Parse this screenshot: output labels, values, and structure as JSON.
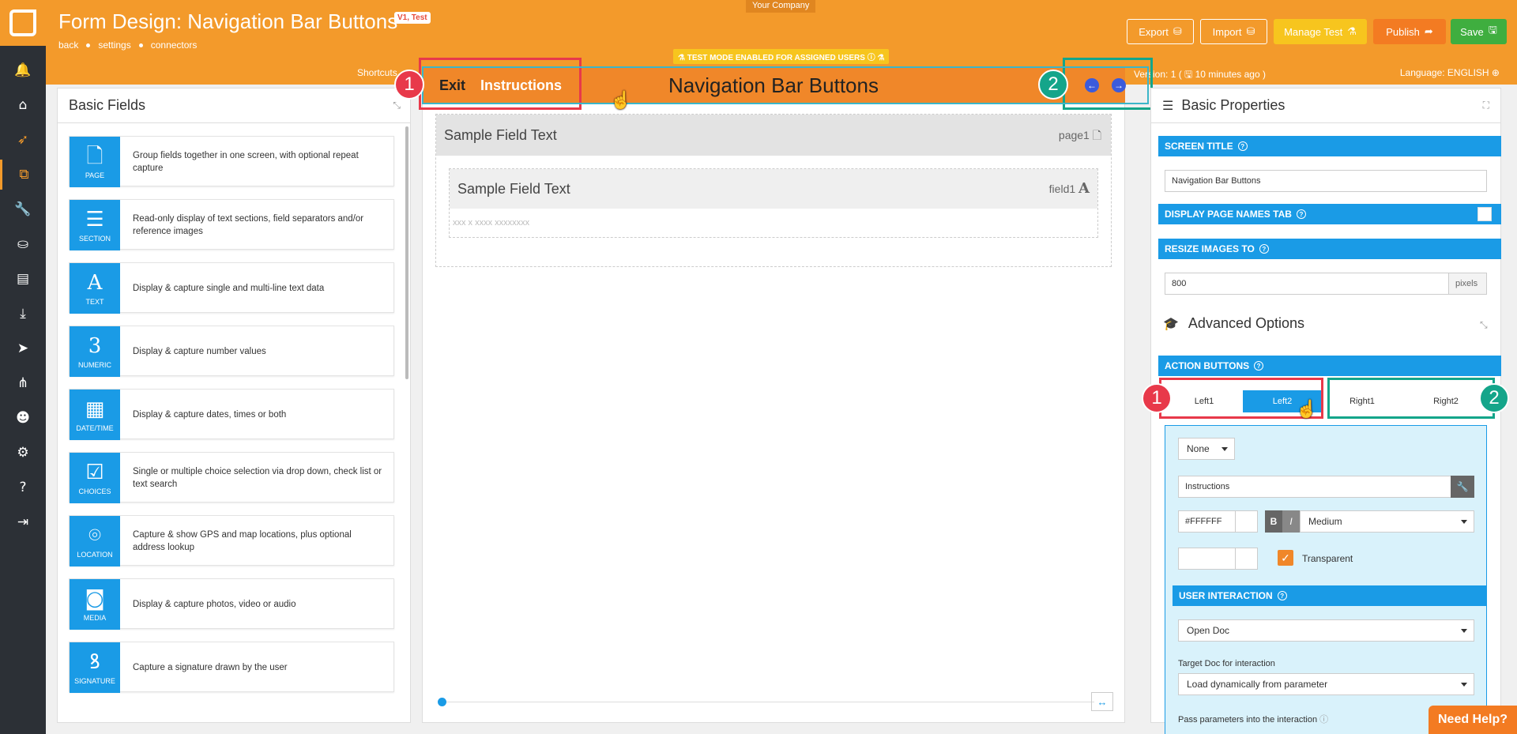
{
  "app": {
    "title": "Form Design: Navigation Bar Buttons",
    "version_badge": "V1, Test",
    "company": "Your Company",
    "breadcrumbs": [
      "back",
      "settings",
      "connectors"
    ],
    "test_mode": "⚗ TEST MODE ENABLED FOR ASSIGNED USERS ⓘ ⚗",
    "shortcuts": "Shortcuts",
    "version": "Version: 1 ( 🖫 10 minutes ago )",
    "language": "Language: ENGLISH ⊕"
  },
  "header_buttons": {
    "export": "Export",
    "import": "Import",
    "manage_test": "Manage Test",
    "publish": "Publish",
    "save": "Save"
  },
  "sidebar_icons": [
    "bell-icon",
    "home-icon",
    "rocket-icon",
    "forms-icon",
    "wrench-icon",
    "basket-icon",
    "table-icon",
    "download-icon",
    "send-icon",
    "sitemap-icon",
    "users-icon",
    "cogs-icon",
    "help-icon",
    "logout-icon"
  ],
  "left_panel": {
    "title": "Basic Fields",
    "fields": [
      {
        "label": "PAGE",
        "glyph": "🗋",
        "desc": "Group fields together in one screen, with optional repeat capture"
      },
      {
        "label": "SECTION",
        "glyph": "☰",
        "desc": "Read-only display of text sections, field separators and/or reference images"
      },
      {
        "label": "TEXT",
        "glyph": "A",
        "desc": "Display & capture single and multi-line text data"
      },
      {
        "label": "NUMERIC",
        "glyph": "3",
        "desc": "Display & capture number values"
      },
      {
        "label": "DATE/TIME",
        "glyph": "▦",
        "desc": "Display & capture dates, times or both"
      },
      {
        "label": "CHOICES",
        "glyph": "☑",
        "desc": "Single or multiple choice selection via drop down, check list or text search"
      },
      {
        "label": "LOCATION",
        "glyph": "⌾",
        "desc": "Capture & show GPS and map locations, plus optional address lookup"
      },
      {
        "label": "MEDIA",
        "glyph": "◙",
        "desc": "Display & capture photos, video or audio"
      },
      {
        "label": "SIGNATURE",
        "glyph": "ꝸ",
        "desc": "Capture a signature drawn by the user"
      }
    ]
  },
  "canvas": {
    "nav_exit": "Exit",
    "nav_instructions": "Instructions",
    "nav_title": "Navigation Bar Buttons",
    "page_field_text": "Sample Field Text",
    "page_tag": "page1",
    "text_field_text": "Sample Field Text",
    "text_field_tag": "field1",
    "text_placeholder": "xxx x xxxx xxxxxxxx",
    "markers": [
      "1",
      "2"
    ]
  },
  "right_panel": {
    "title": "Basic Properties",
    "screen_title_label": "SCREEN TITLE",
    "screen_title_value": "Navigation Bar Buttons",
    "display_page_names_label": "DISPLAY PAGE NAMES TAB",
    "resize_images_label": "RESIZE IMAGES TO",
    "resize_value": "800",
    "resize_unit": "pixels",
    "advanced_title": "Advanced Options",
    "action_buttons_label": "ACTION BUTTONS",
    "tabs": [
      "Left1",
      "Left2",
      "Right1",
      "Right2"
    ],
    "active_tab": "Left2",
    "icon_select": "None",
    "button_text": "Instructions",
    "color_value": "#FFFFFF",
    "bold": "B",
    "italic": "I",
    "size_select": "Medium",
    "transparent_label": "Transparent",
    "user_interaction_label": "USER INTERACTION",
    "interaction_select": "Open Doc",
    "target_doc_label": "Target Doc for interaction",
    "target_doc_select": "Load dynamically from parameter",
    "pass_params_label": "Pass parameters into the interaction"
  },
  "need_help": "Need Help?",
  "colors": {
    "orange": "#f39a2b",
    "blue": "#1a9be6",
    "sidebar": "#2c3036",
    "marker_red": "#e8394a",
    "marker_green": "#14a58a"
  }
}
